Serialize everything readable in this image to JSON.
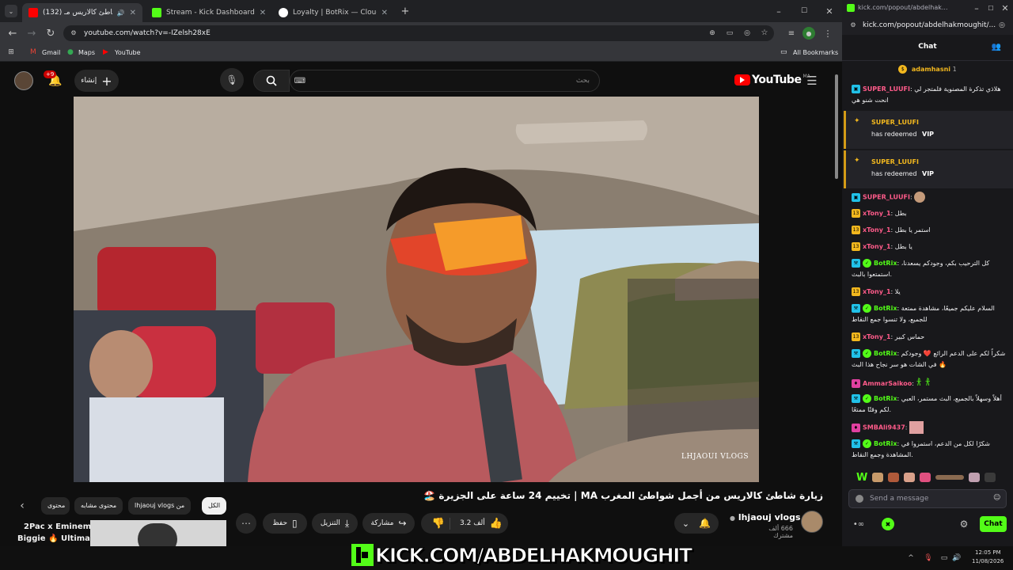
{
  "browser": {
    "tabs": [
      {
        "title": "(132) زيارة شاطئ كالاريس مـ",
        "favicon_color": "#ff0000",
        "active": true
      },
      {
        "title": "Stream - Kick Dashboard",
        "favicon_color": "#53fc18",
        "active": false
      },
      {
        "title": "Loyalty | BotRix — Cloud Stream",
        "favicon_color": "#ffffff",
        "active": false
      }
    ],
    "new_tab": "+",
    "url": "youtube.com/watch?v=-IZelsh28xE",
    "bookmarks": [
      "Gmail",
      "Maps",
      "YouTube"
    ],
    "all_bookmarks": "All Bookmarks"
  },
  "youtube": {
    "create_label": "إنشاء",
    "notif_count": "+9",
    "search_placeholder": "بحث",
    "logo_text": "YouTube",
    "country": "MA",
    "video_watermark": "LHJAOUI VLOGS",
    "title": "زيارة شاطئ كالاريس من أجمل شواطئ المغرب MA | تخييم 24 ساعة على الجزيرة 🏖️",
    "channel": "lhjaouj vlogs",
    "subscribers": "666 ألف مشترك",
    "likes": "3.2 ألف",
    "share": "مشاركة",
    "download": "التنزيل",
    "save": "حفظ",
    "chips": [
      "الكل",
      "من lhjaouj vlogs",
      "محتوى مشابه",
      "محتوى"
    ],
    "rec_title_1": "2Pac x Eminem x",
    "rec_title_2": "Biggie 🔥 Ultimate"
  },
  "kick": {
    "window_url_short": "kick.com/popout/abdelhak...",
    "url": "kick.com/popout/abdelhakmoughit/...",
    "title": "Chat",
    "pinned_user": "adamhasni",
    "pinned_count": "1",
    "messages": [
      {
        "user": "SUPER_LUUFI",
        "color": "#ff5b8a",
        "text": "هلاذي تذكرة المصنوية فلمتجر لي انحت شنو هي"
      },
      {
        "user": "BotRix",
        "color": "#53fc18",
        "text": "كل الترحيب بكم، وجودكم يسعدنا، استمتعوا بالبث."
      },
      {
        "user": "BotRix",
        "color": "#53fc18",
        "text": "السلام عليكم جميعًا، مشاهدة ممتعة للجميع، ولا تنسوا جمع النقاط"
      },
      {
        "user": "BotRix",
        "color": "#53fc18",
        "text": "شكراً لكم على الدعم الرائع ❤️ وجودكم في الشات هو سر نجاح هذا البث 🔥"
      },
      {
        "user": "BotRix",
        "color": "#53fc18",
        "text": "أهلاً وسهلاً بالجميع، البث مستمر، العبي لكم وقتًا ممتعًا."
      },
      {
        "user": "BotRix",
        "color": "#53fc18",
        "text": "شكرًا لكل من الدعم، استمروا في المشاهدة وجمع النقاط."
      }
    ],
    "short_messages": [
      {
        "user": "SUPER_LUUFI",
        "color": "#ff5b8a",
        "text": ""
      },
      {
        "user": "xTony_1",
        "color": "#ff5b8a",
        "text": "بطل"
      },
      {
        "user": "xTony_1",
        "color": "#ff5b8a",
        "text": "استمر يا بطل"
      },
      {
        "user": "xTony_1",
        "color": "#ff5b8a",
        "text": "يا بطل"
      },
      {
        "user": "xTony_1",
        "color": "#ff5b8a",
        "text": "يلا"
      },
      {
        "user": "xTony_1",
        "color": "#ff5b8a",
        "text": "حماس كبير"
      },
      {
        "user": "AmmarSaikoo",
        "color": "#ff5b8a",
        "text": ""
      },
      {
        "user": "SMBAli9437",
        "color": "#ff5b8a",
        "text": ""
      }
    ],
    "redeems": [
      {
        "user": "SUPER_LUUFI",
        "prefix": "has redeemed",
        "item": "VIP"
      },
      {
        "user": "SUPER_LUUFI",
        "prefix": "has redeemed",
        "item": "VIP"
      }
    ],
    "input_placeholder": "Send a message",
    "send_label": "Chat",
    "accent": "#53fc18"
  },
  "overlay": {
    "text": "KICK.COM/ABDELHAKMOUGHIT"
  },
  "taskbar": {
    "time": "12:05 PM",
    "date": "11/08/2026"
  }
}
